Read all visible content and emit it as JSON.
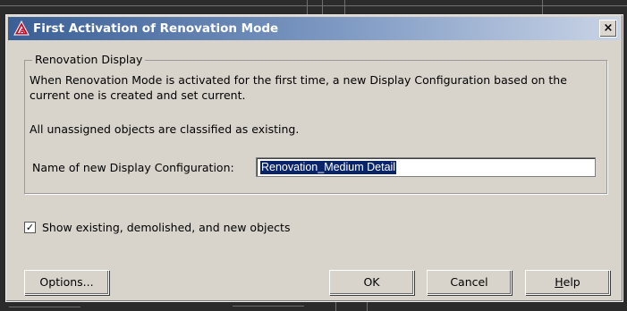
{
  "dialog": {
    "title": "First Activation of Renovation Mode",
    "close_label": "×"
  },
  "group": {
    "legend": "Renovation Display",
    "description_line1": "When Renovation Mode is activated for the first time, a new Display Configuration based on the",
    "description_line2": "current one is created and set current.",
    "note": "All unassigned objects are classified as existing.",
    "config_label": "Name of new Display Configuration:",
    "config_value": "Renovation_Medium Detail"
  },
  "checkbox": {
    "label": "Show existing, demolished, and new objects",
    "checked": true,
    "mark": "✓"
  },
  "buttons": {
    "options": "Options...",
    "ok": "OK",
    "cancel": "Cancel",
    "help_first": "H",
    "help_rest": "elp"
  },
  "colors": {
    "title_start": "#3a5f96",
    "selection": "#0a246a",
    "dialog_bg": "#d8d4cc"
  },
  "icons": {
    "app": "autocad-warning-icon"
  }
}
